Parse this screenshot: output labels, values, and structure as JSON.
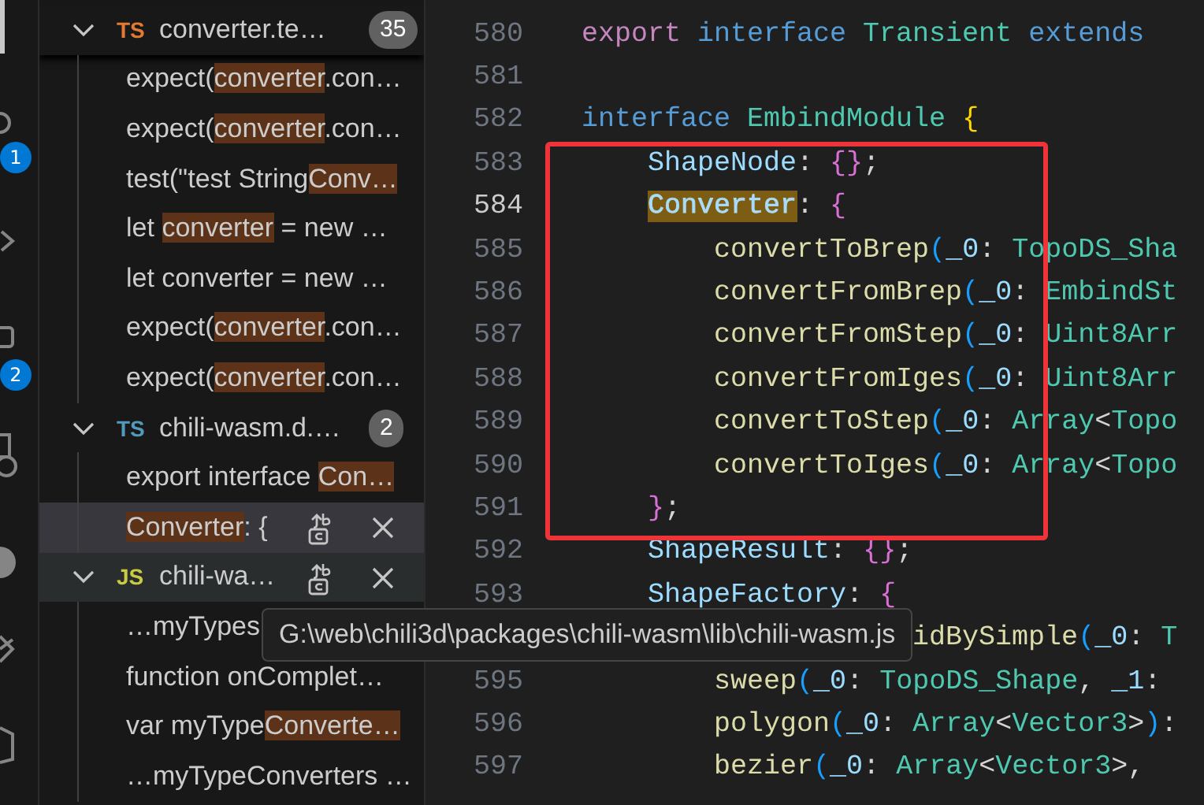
{
  "activity_bar": {
    "badges": [
      {
        "text": "1"
      },
      {
        "text": "2"
      }
    ]
  },
  "search_results": [
    {
      "lang": "TS",
      "color": "#e37933",
      "name": "converter.te…",
      "count": "35",
      "expanded": true,
      "hovered": false,
      "matches": [
        {
          "selected": false,
          "parts": [
            {
              "text": "expect(",
              "hit": false
            },
            {
              "text": "converter",
              "hit": true
            },
            {
              "text": ".con…",
              "hit": false
            }
          ]
        },
        {
          "selected": false,
          "parts": [
            {
              "text": "expect(",
              "hit": false
            },
            {
              "text": "converter",
              "hit": true
            },
            {
              "text": ".con…",
              "hit": false
            }
          ]
        },
        {
          "selected": false,
          "parts": [
            {
              "text": "test(\"test String",
              "hit": false
            },
            {
              "text": "Conv…",
              "hit": true
            }
          ]
        },
        {
          "selected": false,
          "parts": [
            {
              "text": "let ",
              "hit": false
            },
            {
              "text": "converter",
              "hit": true
            },
            {
              "text": " = new …",
              "hit": false
            }
          ]
        },
        {
          "selected": false,
          "parts": [
            {
              "text": "let converter = new …",
              "hit": false
            }
          ]
        },
        {
          "selected": false,
          "parts": [
            {
              "text": "expect(",
              "hit": false
            },
            {
              "text": "converter",
              "hit": true
            },
            {
              "text": ".con…",
              "hit": false
            }
          ]
        },
        {
          "selected": false,
          "parts": [
            {
              "text": "expect(",
              "hit": false
            },
            {
              "text": "converter",
              "hit": true
            },
            {
              "text": ".con…",
              "hit": false
            }
          ]
        }
      ]
    },
    {
      "lang": "TS",
      "color": "#519aba",
      "name": "chili-wasm.d.…",
      "count": "2",
      "expanded": true,
      "hovered": false,
      "matches": [
        {
          "selected": false,
          "parts": [
            {
              "text": "export interface ",
              "hit": false
            },
            {
              "text": "Con…",
              "hit": true
            }
          ]
        },
        {
          "selected": true,
          "parts": [
            {
              "text": "Converter",
              "hit": true
            },
            {
              "text": ": {",
              "hit": false
            }
          ]
        }
      ]
    },
    {
      "lang": "JS",
      "color": "#cbcb41",
      "name": "chili-wa…",
      "expanded": true,
      "hovered": true,
      "matches": [
        {
          "selected": false,
          "parts": [
            {
              "text": "…myTypes",
              "hit": false
            }
          ]
        },
        {
          "selected": false,
          "parts": [
            {
              "text": "function onComplet…",
              "hit": false
            }
          ]
        },
        {
          "selected": false,
          "parts": [
            {
              "text": "var myType",
              "hit": false
            },
            {
              "text": "Converte…",
              "hit": true
            }
          ]
        },
        {
          "selected": false,
          "parts": [
            {
              "text": "…myTypeConverters …",
              "hit": false
            }
          ]
        }
      ]
    }
  ],
  "tooltip": {
    "text": "G:\\web\\chili3d\\packages\\chili-wasm\\lib\\chili-wasm.js"
  },
  "editor": {
    "lines": [
      {
        "number": "580",
        "current": false,
        "tokens": [
          {
            "text": "export ",
            "color": "#c586c0",
            "match": false
          },
          {
            "text": "interface ",
            "color": "#569cd6",
            "match": false
          },
          {
            "text": "Transient ",
            "color": "#4ec9b0",
            "match": false
          },
          {
            "text": "extends",
            "color": "#569cd6",
            "match": false
          }
        ]
      },
      {
        "number": "581",
        "current": false
      },
      {
        "number": "582",
        "current": false,
        "tokens": [
          {
            "text": "interface ",
            "color": "#569cd6",
            "match": false
          },
          {
            "text": "EmbindModule ",
            "color": "#4ec9b0",
            "match": false
          },
          {
            "text": "{",
            "color": "#ffd700",
            "match": false
          }
        ]
      },
      {
        "number": "583",
        "current": false,
        "tokens": [
          {
            "text": "    ShapeNode",
            "color": "#9cdcfe",
            "match": false
          },
          {
            "text": ": ",
            "color": "#d4d4d4",
            "match": false
          },
          {
            "text": "{}",
            "color": "#da70d6",
            "match": false
          },
          {
            "text": ";",
            "color": "#d4d4d4",
            "match": false
          }
        ]
      },
      {
        "number": "584",
        "current": true,
        "tokens": [
          {
            "text": "    Converter",
            "match": true
          },
          {
            "text": ": ",
            "color": "#d4d4d4",
            "match": false
          },
          {
            "text": "{",
            "color": "#da70d6",
            "match": false
          }
        ]
      },
      {
        "number": "585",
        "current": false,
        "tokens": [
          {
            "text": "        convertToBrep",
            "color": "#dcdcaa",
            "match": false
          },
          {
            "text": "(",
            "color": "#179fff",
            "match": false
          },
          {
            "text": "_0",
            "color": "#9cdcfe",
            "match": false
          },
          {
            "text": ": ",
            "color": "#d4d4d4",
            "match": false
          },
          {
            "text": "TopoDS_Sha",
            "color": "#4ec9b0",
            "match": false
          }
        ]
      },
      {
        "number": "586",
        "current": false,
        "tokens": [
          {
            "text": "        convertFromBrep",
            "color": "#dcdcaa",
            "match": false
          },
          {
            "text": "(",
            "color": "#179fff",
            "match": false
          },
          {
            "text": "_0",
            "color": "#9cdcfe",
            "match": false
          },
          {
            "text": ": ",
            "color": "#d4d4d4",
            "match": false
          },
          {
            "text": "EmbindSt",
            "color": "#4ec9b0",
            "match": false
          }
        ]
      },
      {
        "number": "587",
        "current": false,
        "tokens": [
          {
            "text": "        convertFromStep",
            "color": "#dcdcaa",
            "match": false
          },
          {
            "text": "(",
            "color": "#179fff",
            "match": false
          },
          {
            "text": "_0",
            "color": "#9cdcfe",
            "match": false
          },
          {
            "text": ": ",
            "color": "#d4d4d4",
            "match": false
          },
          {
            "text": "Uint8Arr",
            "color": "#4ec9b0",
            "match": false
          }
        ]
      },
      {
        "number": "588",
        "current": false,
        "tokens": [
          {
            "text": "        convertFromIges",
            "color": "#dcdcaa",
            "match": false
          },
          {
            "text": "(",
            "color": "#179fff",
            "match": false
          },
          {
            "text": "_0",
            "color": "#9cdcfe",
            "match": false
          },
          {
            "text": ": ",
            "color": "#d4d4d4",
            "match": false
          },
          {
            "text": "Uint8Arr",
            "color": "#4ec9b0",
            "match": false
          }
        ]
      },
      {
        "number": "589",
        "current": false,
        "tokens": [
          {
            "text": "        convertToStep",
            "color": "#dcdcaa",
            "match": false
          },
          {
            "text": "(",
            "color": "#179fff",
            "match": false
          },
          {
            "text": "_0",
            "color": "#9cdcfe",
            "match": false
          },
          {
            "text": ": ",
            "color": "#d4d4d4",
            "match": false
          },
          {
            "text": "Array",
            "color": "#4ec9b0",
            "match": false
          },
          {
            "text": "<",
            "color": "#d4d4d4",
            "match": false
          },
          {
            "text": "Topo",
            "color": "#4ec9b0",
            "match": false
          }
        ]
      },
      {
        "number": "590",
        "current": false,
        "tokens": [
          {
            "text": "        convertToIges",
            "color": "#dcdcaa",
            "match": false
          },
          {
            "text": "(",
            "color": "#179fff",
            "match": false
          },
          {
            "text": "_0",
            "color": "#9cdcfe",
            "match": false
          },
          {
            "text": ": ",
            "color": "#d4d4d4",
            "match": false
          },
          {
            "text": "Array",
            "color": "#4ec9b0",
            "match": false
          },
          {
            "text": "<",
            "color": "#d4d4d4",
            "match": false
          },
          {
            "text": "Topo",
            "color": "#4ec9b0",
            "match": false
          }
        ]
      },
      {
        "number": "591",
        "current": false,
        "tokens": [
          {
            "text": "    }",
            "color": "#da70d6",
            "match": false
          },
          {
            "text": ";",
            "color": "#d4d4d4",
            "match": false
          }
        ]
      },
      {
        "number": "592",
        "current": false,
        "tokens": [
          {
            "text": "    ShapeResult",
            "color": "#9cdcfe",
            "match": false
          },
          {
            "text": ": ",
            "color": "#d4d4d4",
            "match": false
          },
          {
            "text": "{}",
            "color": "#da70d6",
            "match": false
          },
          {
            "text": ";",
            "color": "#d4d4d4",
            "match": false
          }
        ]
      },
      {
        "number": "593",
        "current": false,
        "tokens": [
          {
            "text": "    ShapeFactory",
            "color": "#9cdcfe",
            "match": false
          },
          {
            "text": ": ",
            "color": "#d4d4d4",
            "match": false
          },
          {
            "text": "{",
            "color": "#da70d6",
            "match": false
          }
        ]
      },
      {
        "tokens": [
          {
            "text": "                    idBySimple",
            "color": "#dcdcaa",
            "match": false
          },
          {
            "text": "(",
            "color": "#179fff",
            "match": false
          },
          {
            "text": "_0",
            "color": "#9cdcfe",
            "match": false
          },
          {
            "text": ": ",
            "color": "#d4d4d4",
            "match": false
          },
          {
            "text": "T",
            "color": "#4ec9b0",
            "match": false
          }
        ]
      },
      {
        "number": "595",
        "current": false,
        "tokens": [
          {
            "text": "        sweep",
            "color": "#dcdcaa",
            "match": false
          },
          {
            "text": "(",
            "color": "#179fff",
            "match": false
          },
          {
            "text": "_0",
            "color": "#9cdcfe",
            "match": false
          },
          {
            "text": ": ",
            "color": "#d4d4d4",
            "match": false
          },
          {
            "text": "TopoDS_Shape",
            "color": "#4ec9b0",
            "match": false
          },
          {
            "text": ", ",
            "color": "#d4d4d4",
            "match": false
          },
          {
            "text": "_1",
            "color": "#9cdcfe",
            "match": false
          },
          {
            "text": ":",
            "color": "#d4d4d4",
            "match": false
          }
        ]
      },
      {
        "number": "596",
        "current": false,
        "tokens": [
          {
            "text": "        polygon",
            "color": "#dcdcaa",
            "match": false
          },
          {
            "text": "(",
            "color": "#179fff",
            "match": false
          },
          {
            "text": "_0",
            "color": "#9cdcfe",
            "match": false
          },
          {
            "text": ": ",
            "color": "#d4d4d4",
            "match": false
          },
          {
            "text": "Array",
            "color": "#4ec9b0",
            "match": false
          },
          {
            "text": "<",
            "color": "#d4d4d4",
            "match": false
          },
          {
            "text": "Vector3",
            "color": "#4ec9b0",
            "match": false
          },
          {
            "text": ">",
            "color": "#d4d4d4",
            "match": false
          },
          {
            "text": ")",
            "color": "#179fff",
            "match": false
          },
          {
            "text": ":",
            "color": "#d4d4d4",
            "match": false
          }
        ]
      },
      {
        "number": "597",
        "current": false,
        "tokens": [
          {
            "text": "        bezier",
            "color": "#dcdcaa",
            "match": false
          },
          {
            "text": "(",
            "color": "#179fff",
            "match": false
          },
          {
            "text": "_0",
            "color": "#9cdcfe",
            "match": false
          },
          {
            "text": ": ",
            "color": "#d4d4d4",
            "match": false
          },
          {
            "text": "Array",
            "color": "#4ec9b0",
            "match": false
          },
          {
            "text": "<",
            "color": "#d4d4d4",
            "match": false
          },
          {
            "text": "Vector3",
            "color": "#4ec9b0",
            "match": false
          },
          {
            "text": ">",
            "color": "#d4d4d4",
            "match": false
          },
          {
            "text": ",",
            "color": "#d4d4d4",
            "match": false
          }
        ]
      }
    ]
  }
}
